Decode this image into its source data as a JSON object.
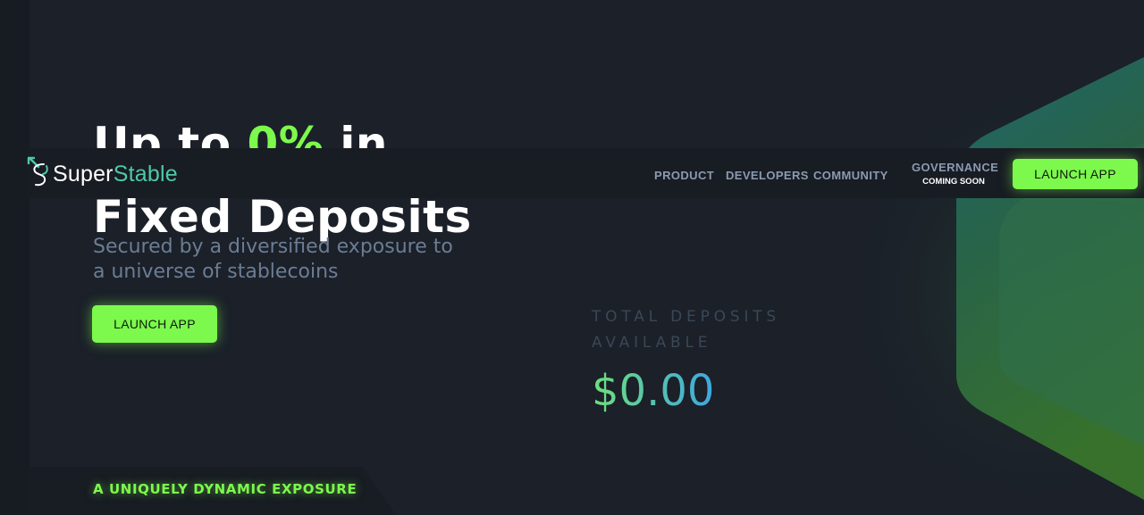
{
  "hero": {
    "line1_before": "Up to ",
    "line1_accent": "0%",
    "line1_after": " in",
    "line2": "Fixed Deposits",
    "subtitle": "Secured by a diversified exposure to a universe of stablecoins",
    "cta_label": "LAUNCH APP"
  },
  "navbar": {
    "logo_part1": "Super",
    "logo_part2": "Stable",
    "links": [
      "PRODUCT",
      "DEVELOPERS",
      "COMMUNITY"
    ],
    "governance_label": "GOVERNANCE",
    "governance_badge": "COMING SOON",
    "cta_label": "LAUNCH APP"
  },
  "deposits": {
    "label": "TOTAL DEPOSITS AVAILABLE",
    "value": "$0.00"
  },
  "section": {
    "heading": "A UNIQUELY DYNAMIC EXPOSURE"
  },
  "icons": {
    "logo": "superstable-logo-icon"
  },
  "colors": {
    "background": "#1b2029",
    "accent": "#7cf94c",
    "navbar": "#181c23",
    "muted_text": "#6b7d93",
    "deposit_gradient_start": "#6ee07a",
    "deposit_gradient_end": "#3fa7e0"
  }
}
